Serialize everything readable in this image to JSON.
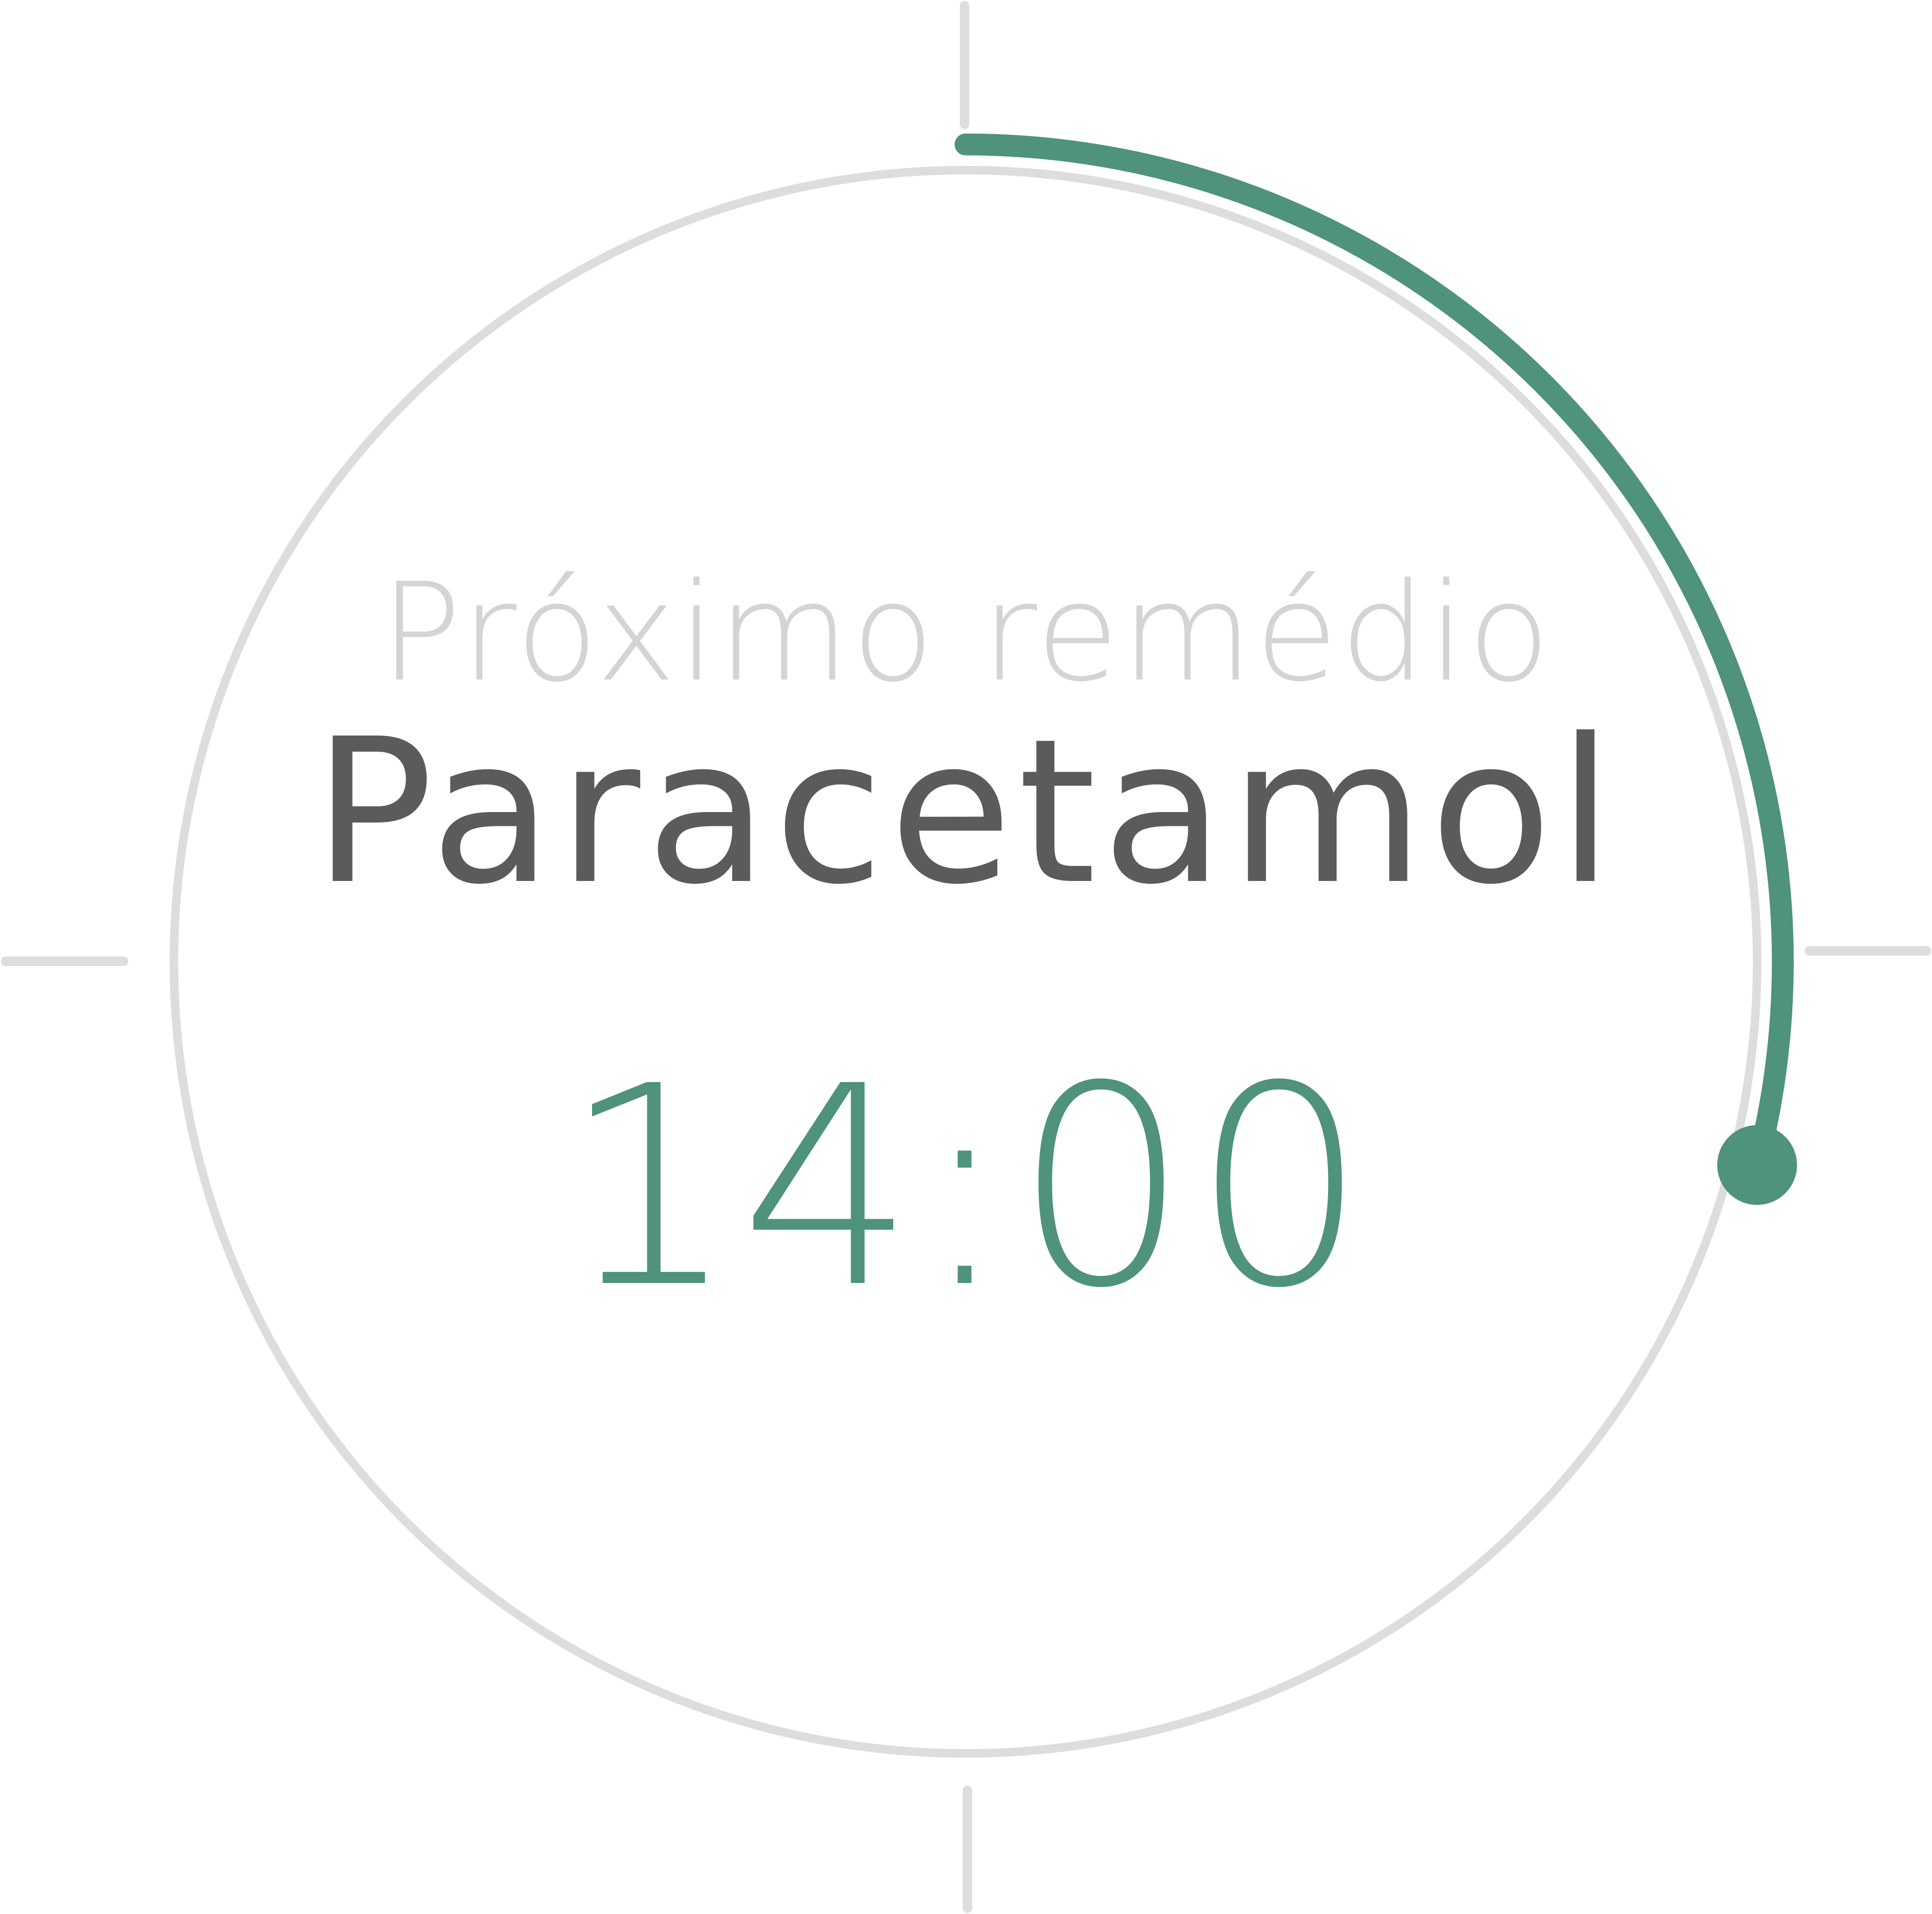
{
  "next_label": "Próximo remédio",
  "medicine_name": "Paracetamol",
  "time": "14:00",
  "progress_fraction": 0.29,
  "colors": {
    "accent": "#4e937a",
    "track": "#dddddd",
    "tick": "#dddddd",
    "label": "#d4d4d4",
    "name": "#5b5b5b",
    "time": "#4e937a"
  }
}
